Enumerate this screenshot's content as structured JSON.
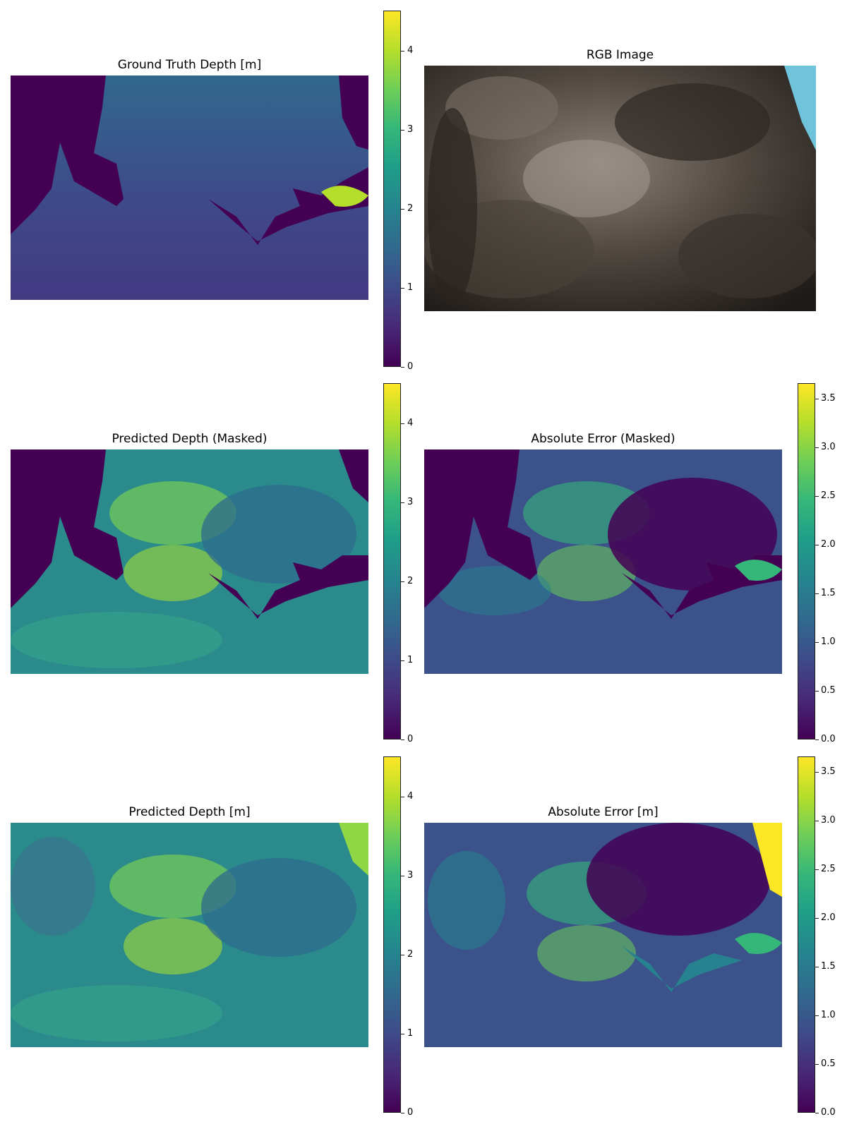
{
  "panels": [
    {
      "id": "gt",
      "title": "Ground Truth Depth [m]",
      "kind": "depth-gt"
    },
    {
      "id": "rgb",
      "title": "RGB Image",
      "kind": "rgb"
    },
    {
      "id": "pred_masked",
      "title": "Predicted Depth (Masked)",
      "kind": "depth-pred-masked"
    },
    {
      "id": "err_masked",
      "title": "Absolute Error (Masked)",
      "kind": "error-masked"
    },
    {
      "id": "pred",
      "title": "Predicted Depth [m]",
      "kind": "depth-pred"
    },
    {
      "id": "err",
      "title": "Absolute Error [m]",
      "kind": "error"
    }
  ],
  "colorbars": [
    {
      "id": "cb-gt",
      "colormap": "viridis",
      "range": [
        0,
        4.5
      ],
      "ticks": [
        "0",
        "1",
        "2",
        "3",
        "4"
      ],
      "values": [
        0,
        1,
        2,
        3,
        4
      ]
    },
    {
      "id": "cb-pred-masked",
      "colormap": "viridis",
      "range": [
        0,
        4.5
      ],
      "ticks": [
        "0",
        "1",
        "2",
        "3",
        "4"
      ],
      "values": [
        0,
        1,
        2,
        3,
        4
      ]
    },
    {
      "id": "cb-err-masked",
      "colormap": "viridis",
      "range": [
        0,
        3.65
      ],
      "ticks": [
        "0.0",
        "0.5",
        "1.0",
        "1.5",
        "2.0",
        "2.5",
        "3.0",
        "3.5"
      ],
      "values": [
        0,
        0.5,
        1.0,
        1.5,
        2.0,
        2.5,
        3.0,
        3.5
      ]
    },
    {
      "id": "cb-pred",
      "colormap": "viridis",
      "range": [
        0,
        4.5
      ],
      "ticks": [
        "0",
        "1",
        "2",
        "3",
        "4"
      ],
      "values": [
        0,
        1,
        2,
        3,
        4
      ]
    },
    {
      "id": "cb-err",
      "colormap": "viridis",
      "range": [
        0,
        3.65
      ],
      "ticks": [
        "0.0",
        "0.5",
        "1.0",
        "1.5",
        "2.0",
        "2.5",
        "3.0",
        "3.5"
      ],
      "values": [
        0,
        0.5,
        1.0,
        1.5,
        2.0,
        2.5,
        3.0,
        3.5
      ]
    }
  ],
  "chart_data": {
    "type": "heatmap",
    "colormap": "viridis",
    "depth_range_m": [
      0,
      4.5
    ],
    "error_range_m": [
      0,
      3.65
    ]
  }
}
